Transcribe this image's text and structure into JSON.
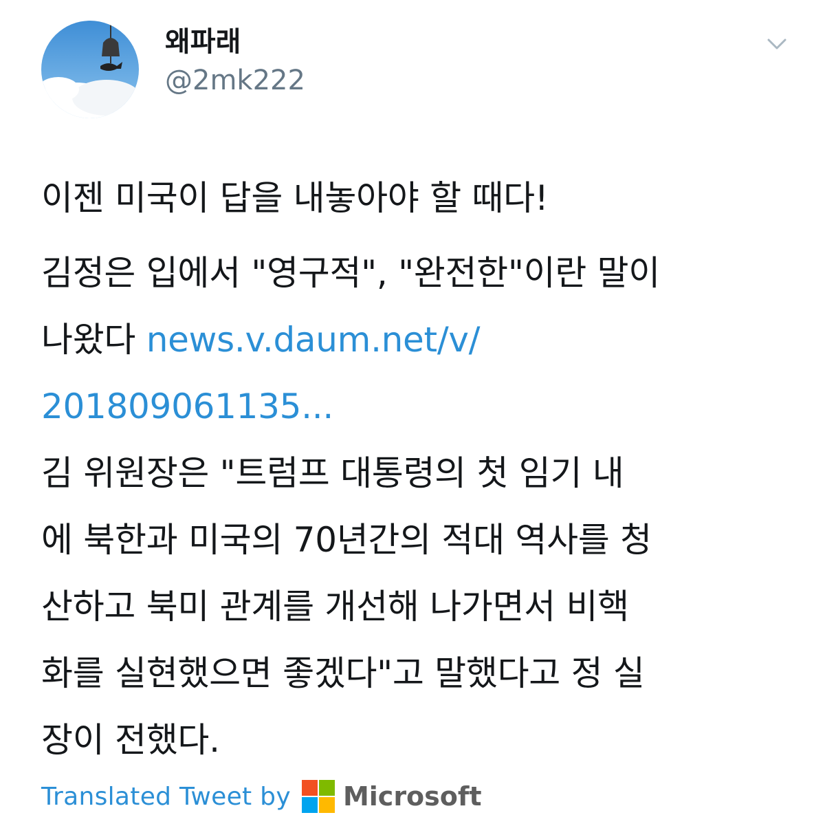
{
  "user": {
    "display_name": "왜파래",
    "handle": "@2mk222",
    "avatar_icon": "sky-bell-avatar"
  },
  "menu": {
    "caret_icon": "chevron-down-icon"
  },
  "tweet": {
    "headline": "이젠 미국이 답을 내놓아야 할 때다!",
    "para2_line1": "김정은 입에서 \"영구적\", \"완전한\"이란 말이",
    "para2_line2_text": "나왔다",
    "link_part1": "news.v.daum.net/v/",
    "link_part2": "201809061135...",
    "quote_lines": [
      "김 위원장은 \"트럼프 대통령의 첫 임기 내",
      "에 북한과 미국의 70년간의 적대 역사를 청",
      "산하고 북미 관계를 개선해 나가면서 비핵",
      "화를 실현했으면 좋겠다\"고 말했다고 정 실",
      "장이 전했다."
    ]
  },
  "translation": {
    "label": "Translated Tweet by",
    "provider": "Microsoft",
    "logo_colors": [
      "#f25022",
      "#7fba00",
      "#00a4ef",
      "#ffb900"
    ]
  }
}
